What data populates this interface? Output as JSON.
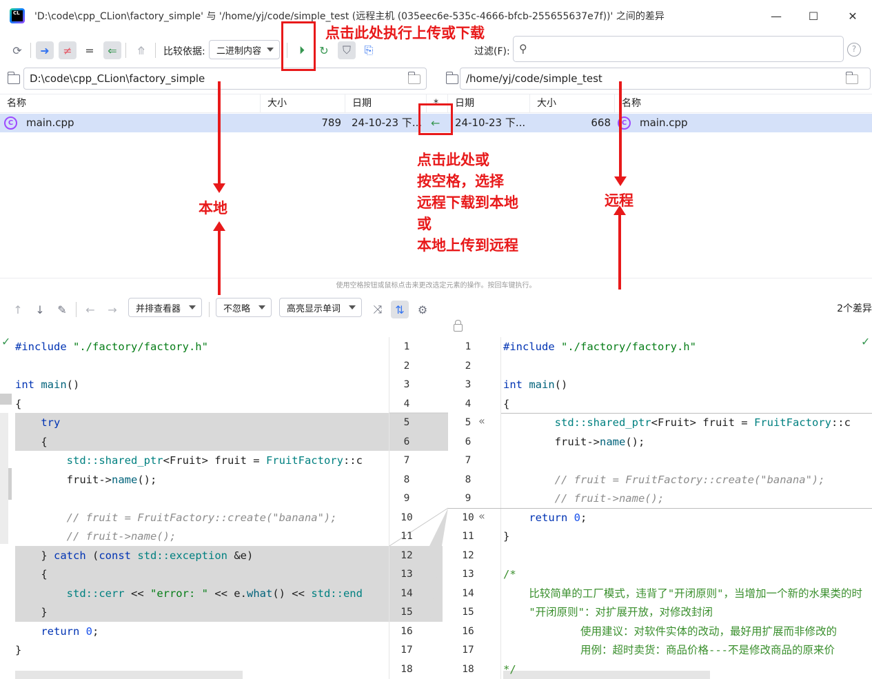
{
  "window": {
    "title": "'D:\\code\\cpp_CLion\\factory_simple' 与 '/home/yj/code/simple_test (远程主机 (035eec6e-535c-4666-bfcb-255655637e7f))' 之间的差异",
    "logo_text": "CL",
    "minimize": "—",
    "maximize": "☐",
    "close": "✕"
  },
  "toolbar": {
    "compare_label": "比较依据:",
    "compare_value": "二进制内容",
    "filter_label": "过滤(F):",
    "filter_placeholder": "",
    "help": "?"
  },
  "paths": {
    "local": "D:\\code\\cpp_CLion\\factory_simple",
    "remote": "/home/yj/code/simple_test"
  },
  "table": {
    "headers": {
      "name_left": "名称",
      "size_left": "大小",
      "date_left": "日期",
      "star": "*",
      "date_right": "日期",
      "size_right": "大小",
      "name_right": "名称"
    },
    "row": {
      "name_left": "main.cpp",
      "size_left": "789",
      "date_left": "24-10-23 下...",
      "action": "←",
      "date_right": "24-10-23 下...",
      "size_right": "668",
      "name_right": "main.cpp"
    }
  },
  "hint": "使用空格按钮或鼠标点击来更改选定元素的操作。按回车键执行。",
  "diff_toolbar": {
    "viewer": "并排查看器",
    "ignore": "不忽略",
    "highlight": "高亮显示单词",
    "diff_count": "2个差异"
  },
  "annotations": {
    "execute": "点击此处执行上传或下载",
    "local": "本地",
    "remote": "远程",
    "middle": [
      "点击此处或",
      "按空格，选择",
      "远程下载到本地",
      "或",
      "本地上传到远程"
    ]
  },
  "editor": {
    "left_numbers": [
      "1",
      "2",
      "3",
      "4",
      "5",
      "6",
      "7",
      "8",
      "9",
      "10",
      "11",
      "12",
      "13",
      "14",
      "15",
      "16",
      "17",
      "18"
    ],
    "right_numbers": [
      "1",
      "2",
      "3",
      "4",
      "5",
      "6",
      "7",
      "8",
      "9",
      "10",
      "11",
      "12",
      "13",
      "14",
      "15",
      "16",
      "17",
      "18"
    ],
    "left_lines": [
      "#include \"./factory/factory.h\"",
      "",
      "int main()",
      "{",
      "    try",
      "    {",
      "        std::shared_ptr<Fruit> fruit = FruitFactory::c",
      "        fruit->name();",
      "",
      "        // fruit = FruitFactory::create(\"banana\");",
      "        // fruit->name();",
      "    } catch (const std::exception &e)",
      "    {",
      "        std::cerr << \"error: \" << e.what() << std::end",
      "    }",
      "    return 0;",
      "}",
      ""
    ],
    "right_lines": [
      "#include \"./factory/factory.h\"",
      "",
      "int main()",
      "{",
      "        std::shared_ptr<Fruit> fruit = FruitFactory::c",
      "        fruit->name();",
      "",
      "        // fruit = FruitFactory::create(\"banana\");",
      "        // fruit->name();",
      "    return 0;",
      "}",
      "",
      "/*",
      "    比较简单的工厂模式，违背了\"开闭原则\"，当增加一个新的水果类的时",
      "    \"开闭原则\"：对扩展开放，对修改封闭",
      "            使用建议：对软件实体的改动，最好用扩展而非修改的",
      "            用例：超时卖货：商品价格---不是修改商品的原来价",
      "*/"
    ]
  },
  "colors": {
    "selection": "#d5e1f9",
    "annotation_red": "#e8191a",
    "diff_block": "#d9d9d9"
  }
}
